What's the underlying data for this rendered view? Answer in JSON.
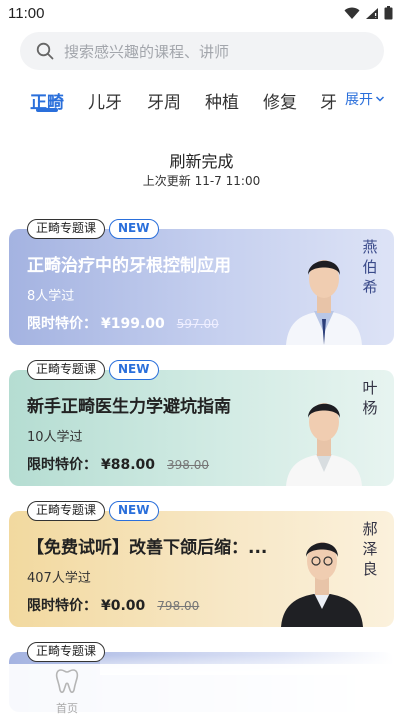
{
  "status_bar": {
    "time": "11:00"
  },
  "search": {
    "placeholder": "搜索感兴趣的课程、讲师"
  },
  "tabs": [
    {
      "label": "正畸",
      "active": true
    },
    {
      "label": "儿牙",
      "active": false
    },
    {
      "label": "牙周",
      "active": false
    },
    {
      "label": "种植",
      "active": false
    },
    {
      "label": "修复",
      "active": false
    },
    {
      "label": "牙",
      "active": false
    }
  ],
  "expand_label": "展开",
  "refresh": {
    "title": "刷新完成",
    "subtitle": "上次更新 11-7 11:00"
  },
  "courses": [
    {
      "category": "正畸专题课",
      "badge": "NEW",
      "title": "正畸治疗中的牙根控制应用",
      "learners": "8人学过",
      "price_label": "限时特价：",
      "price": "¥199.00",
      "original_price": "597.00",
      "teacher": "燕伯希"
    },
    {
      "category": "正畸专题课",
      "badge": "NEW",
      "title": "新手正畸医生力学避坑指南",
      "learners": "10人学过",
      "price_label": "限时特价：",
      "price": "¥88.00",
      "original_price": "398.00",
      "teacher": "叶杨"
    },
    {
      "category": "正畸专题课",
      "badge": "NEW",
      "title": "【免费试听】改善下颌后缩：...",
      "learners": "407人学过",
      "price_label": "限时特价：",
      "price": "¥0.00",
      "original_price": "798.00",
      "teacher": "郝泽良"
    },
    {
      "category": "正畸专题课"
    }
  ],
  "bottom_nav": {
    "home_label": "首页"
  },
  "colors": {
    "accent": "#2a6fdb"
  }
}
